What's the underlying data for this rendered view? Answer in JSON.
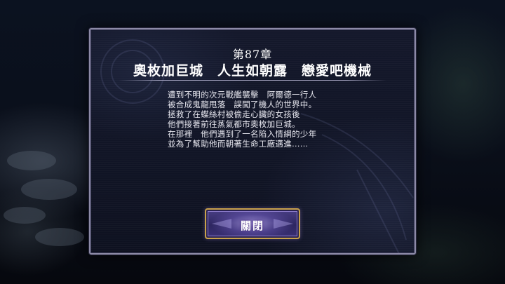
{
  "dialog": {
    "chapter": "第87章",
    "title": "奧枚加巨城　人生如朝露　戀愛吧機械",
    "story_lines": [
      "遭到不明的次元戰艦襲擊　阿爾德一行人",
      "被合成鬼龍甩落　誤闖了機人的世界中。",
      "拯救了在蝶絲村被偷走心臟的女孩後",
      "他們接著前往蒸氣都市奧枚加巨城。",
      "在那裡　他們遇到了一名陷入情網的少年",
      "並為了幫助他而朝著生命工廠邁進……"
    ],
    "close_label": "關閉"
  },
  "colors": {
    "panel_border": "#8c8aa6",
    "button_border": "#c9a24a",
    "button_fill": "#4a3f86",
    "text": "#ffffff"
  }
}
